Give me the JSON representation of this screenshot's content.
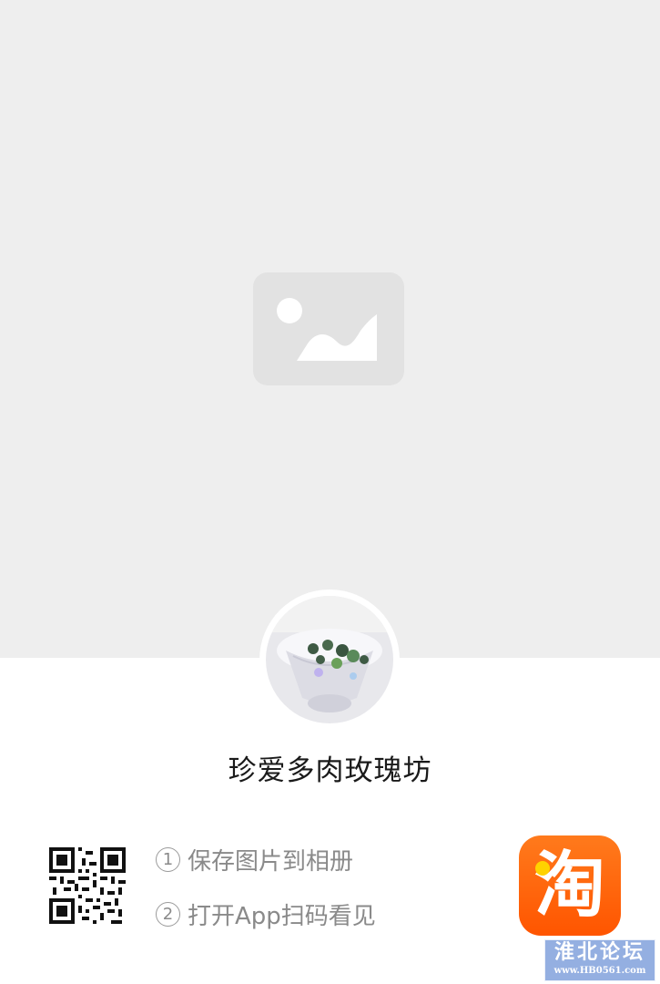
{
  "cover": {
    "placeholder_icon": "image-placeholder-icon",
    "background_color": "#eeeeee"
  },
  "shop": {
    "avatar_icon": "shop-avatar-photo",
    "name": "珍爱多肉玫瑰坊"
  },
  "instructions": {
    "qr_icon": "qr-code-icon",
    "steps": [
      {
        "num": "1",
        "text": "保存图片到相册"
      },
      {
        "num": "2",
        "text": "打开App扫码看见"
      }
    ]
  },
  "app_logo": {
    "icon": "taobao-logo-icon",
    "glyph": "淘",
    "brand_color": "#ff5500"
  },
  "watermark": {
    "title": "淮北论坛",
    "url": "www.HB0561.com"
  }
}
